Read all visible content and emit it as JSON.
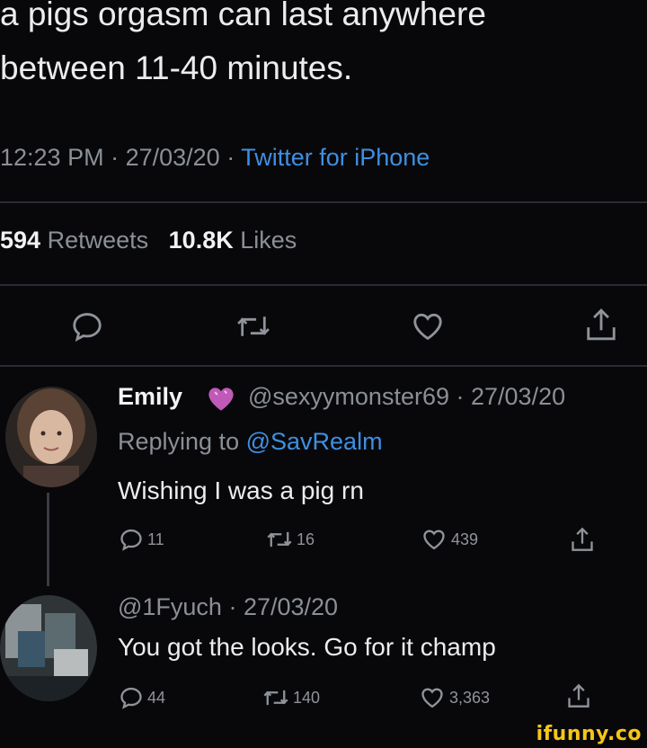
{
  "tweet": {
    "text": "a pigs orgasm can last anywhere\nbetween 11-40 minutes.",
    "time": "12:23 PM",
    "date": "27/03/20",
    "source": "Twitter for iPhone",
    "retweets_count": "594",
    "retweets_label": "Retweets",
    "likes_count": "10.8K",
    "likes_label": "Likes"
  },
  "actions": {
    "reply_icon": "reply-icon",
    "retweet_icon": "retweet-icon",
    "like_icon": "heart-icon",
    "share_icon": "share-icon"
  },
  "reply1": {
    "name": "Emily",
    "emoji": "💜",
    "handle": "@sexyymonster69",
    "date": "27/03/20",
    "replying_label": "Replying to",
    "replying_to": "@SavRealm",
    "text": "Wishing I was a pig rn",
    "reply_count": "11",
    "retweet_count": "16",
    "like_count": "439"
  },
  "reply2": {
    "handle": "@1Fyuch",
    "date": "27/03/20",
    "text": "You got the looks. Go for it champ",
    "reply_count": "44",
    "retweet_count": "140",
    "like_count": "3,363"
  },
  "watermark": "ifunny.co",
  "colors": {
    "background": "#08080b",
    "accent": "#3f8fe0",
    "muted": "#8b8f96",
    "watermark": "#f5c518"
  }
}
